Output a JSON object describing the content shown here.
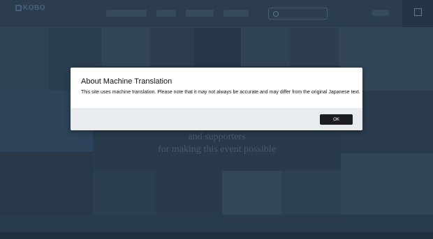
{
  "dialog": {
    "title": "About Machine Translation",
    "body": "This site uses machine translation. Please note that it may not always be accurate and may differ from the original Japanese text.",
    "ok_label": "OK"
  },
  "background": {
    "thanks_line_1": "and supporters",
    "thanks_line_2": "for making this event possible"
  }
}
